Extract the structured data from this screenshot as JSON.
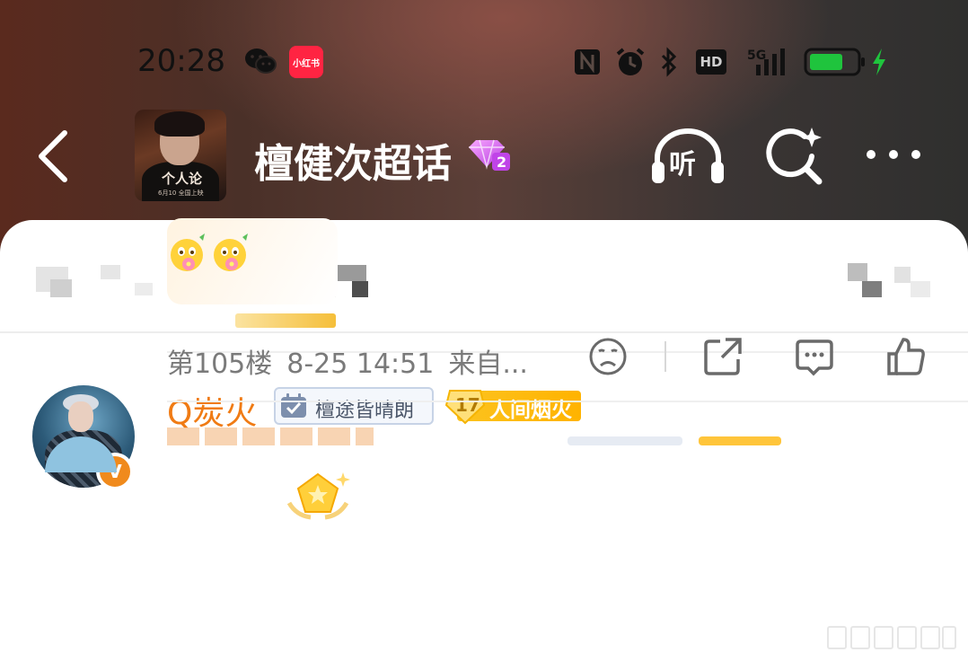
{
  "status_bar": {
    "time": "20:28",
    "app_badge": "小红书",
    "network": "5G",
    "hd_label": "HD"
  },
  "nav": {
    "topic_title": "檀健次超话",
    "cover_title": "个人论",
    "cover_sub": "6月10 全国上映",
    "listen_label": "听",
    "icons": [
      "back-arrow-icon",
      "gem-level-icon",
      "headphones-icon",
      "search-sparkle-icon",
      "more-dots-icon"
    ]
  },
  "comment": {
    "username": "Q炭火",
    "fan_badge": "檀途皆晴朗",
    "level_number": "17",
    "level_title": "人间烟火",
    "verified_badge": "V",
    "floor": "第105楼",
    "date": "8-25 14:51",
    "source": "来自...",
    "actions": [
      "dislike-face-icon",
      "share-icon",
      "comment-icon",
      "like-icon"
    ]
  },
  "colors": {
    "username": "#f07b14",
    "level_badge": "#fcc31f",
    "verified": "#f08a1c"
  }
}
